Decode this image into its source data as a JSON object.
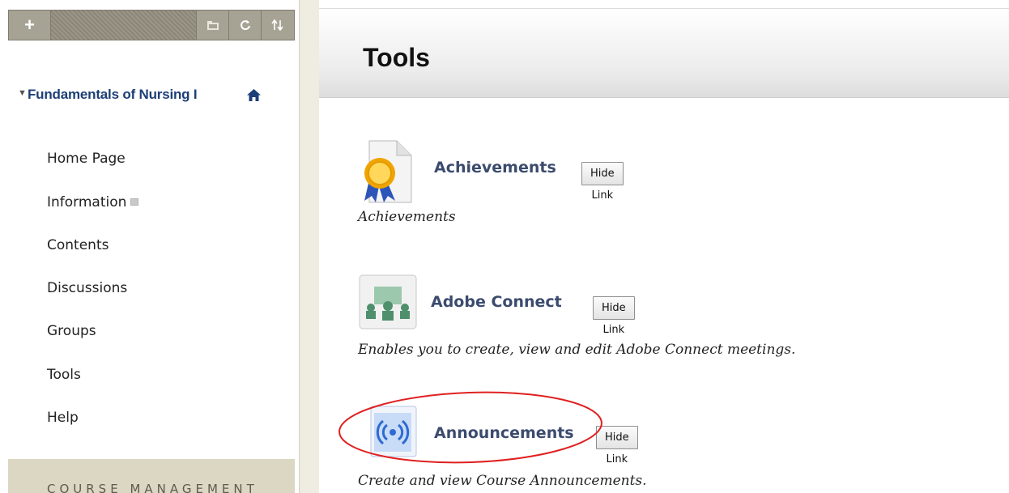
{
  "sidebar": {
    "toolbar": {
      "add_label": "+",
      "folder_icon": "folder-icon",
      "refresh_icon": "refresh-icon",
      "sort_icon": "sort-icon"
    },
    "course_title": "Fundamentals of Nursing I",
    "items": [
      {
        "label": "Home Page"
      },
      {
        "label": "Information"
      },
      {
        "label": "Contents"
      },
      {
        "label": "Discussions"
      },
      {
        "label": "Groups"
      },
      {
        "label": "Tools"
      },
      {
        "label": "Help"
      }
    ],
    "course_management": "COURSE MANAGEMENT"
  },
  "page": {
    "title": "Tools"
  },
  "tools": [
    {
      "name": "Achievements",
      "button": "Hide Link",
      "description": "Achievements",
      "icon": "achievement-ribbon-icon"
    },
    {
      "name": "Adobe Connect",
      "button": "Hide Link",
      "description": "Enables you to create, view and edit Adobe Connect meetings.",
      "icon": "adobe-connect-meeting-icon"
    },
    {
      "name": "Announcements",
      "button": "Hide Link",
      "description": "Create and view Course Announcements.",
      "icon": "announcement-broadcast-icon"
    }
  ],
  "colors": {
    "link": "#3b4b6e",
    "course_title": "#1d3f77",
    "highlight": "#e02020"
  }
}
